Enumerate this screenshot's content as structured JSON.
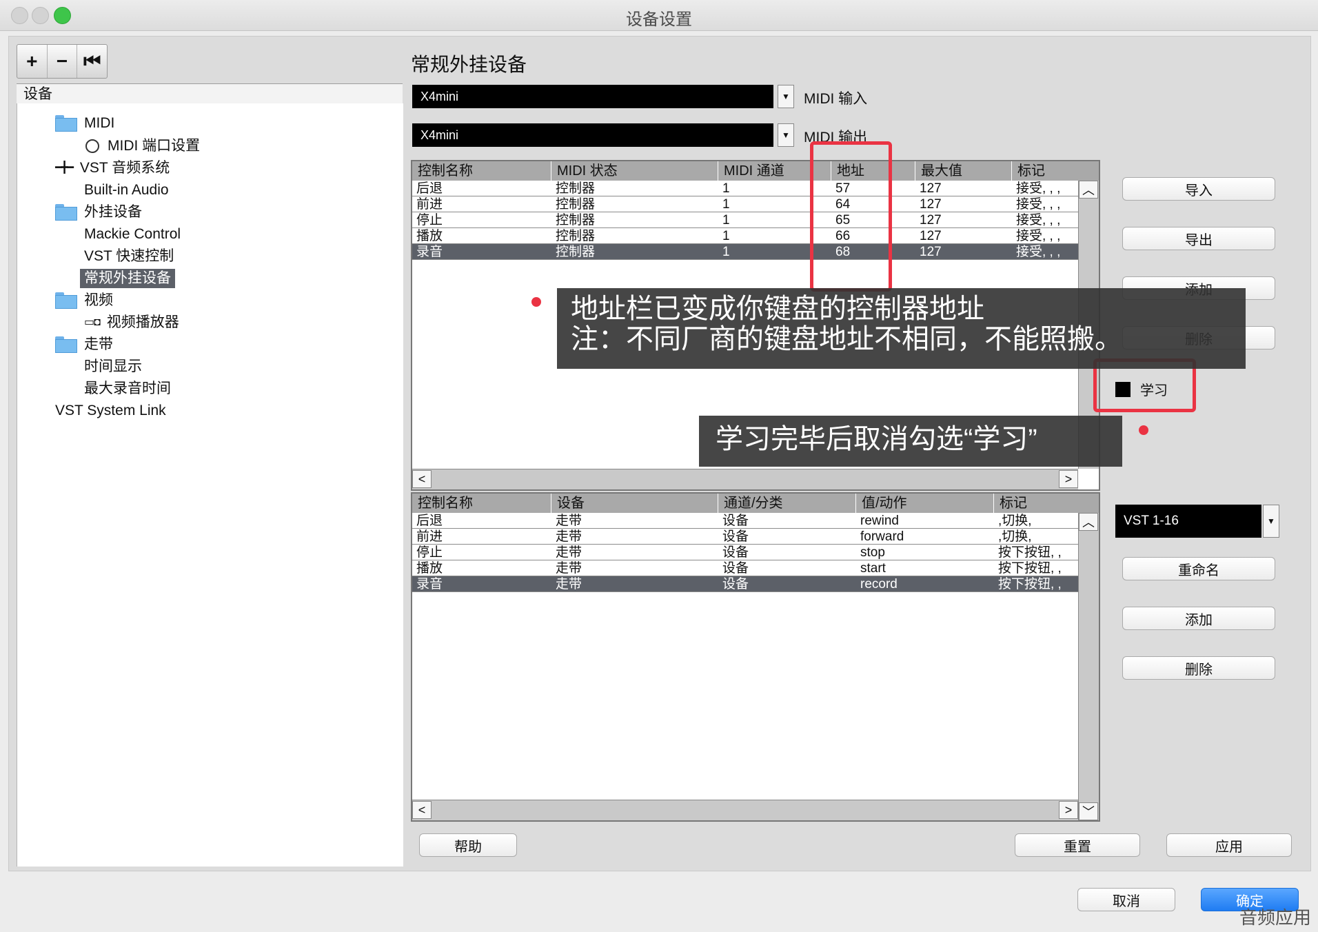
{
  "window": {
    "title": "设备设置"
  },
  "toolbar": {
    "add": "+",
    "remove": "−",
    "reset": "⏮"
  },
  "sidebar": {
    "header": "设备",
    "items": [
      {
        "label": "MIDI",
        "icon": "folder-icon"
      },
      {
        "label": "MIDI 端口设置",
        "icon": "clock-icon"
      },
      {
        "label": "VST 音频系统",
        "icon": "audio-icon"
      },
      {
        "label": "Built-in Audio"
      },
      {
        "label": "外挂设备",
        "icon": "folder-icon"
      },
      {
        "label": "Mackie Control"
      },
      {
        "label": "VST 快速控制"
      },
      {
        "label": "常规外挂设备",
        "selected": true
      },
      {
        "label": "视频",
        "icon": "folder-icon"
      },
      {
        "label": "视频播放器",
        "icon": "video-icon"
      },
      {
        "label": "走带",
        "icon": "folder-icon"
      },
      {
        "label": "时间显示"
      },
      {
        "label": "最大录音时间"
      },
      {
        "label": "VST System Link"
      }
    ]
  },
  "main": {
    "title": "常规外挂设备",
    "midi_input": {
      "value": "X4mini",
      "label": "MIDI 输入"
    },
    "midi_output": {
      "value": "X4mini",
      "label": "MIDI 输出"
    },
    "table1": {
      "headers": [
        "控制名称",
        "MIDI 状态",
        "MIDI 通道",
        "地址",
        "最大值",
        "标记"
      ],
      "rows": [
        [
          "后退",
          "控制器",
          "1",
          "57",
          "127",
          "接受, , ,"
        ],
        [
          "前进",
          "控制器",
          "1",
          "64",
          "127",
          "接受, , ,"
        ],
        [
          "停止",
          "控制器",
          "1",
          "65",
          "127",
          "接受, , ,"
        ],
        [
          "播放",
          "控制器",
          "1",
          "66",
          "127",
          "接受, , ,"
        ],
        [
          "录音",
          "控制器",
          "1",
          "68",
          "127",
          "接受, , ,"
        ]
      ]
    },
    "table2": {
      "headers": [
        "控制名称",
        "设备",
        "通道/分类",
        "值/动作",
        "标记"
      ],
      "rows": [
        [
          "后退",
          "走带",
          "设备",
          "rewind",
          ",切换,"
        ],
        [
          "前进",
          "走带",
          "设备",
          "forward",
          ",切换,"
        ],
        [
          "停止",
          "走带",
          "设备",
          "stop",
          "按下按钮, ,"
        ],
        [
          "播放",
          "走带",
          "设备",
          "start",
          "按下按钮, ,"
        ],
        [
          "录音",
          "走带",
          "设备",
          "record",
          "按下按钮, ,"
        ]
      ]
    },
    "right_buttons": {
      "import": "导入",
      "export": "导出",
      "add": "添加",
      "delete": "删除",
      "learn": "学习"
    },
    "vst_select": "VST 1-16",
    "right_buttons2": {
      "rename": "重命名",
      "add": "添加",
      "delete": "删除"
    }
  },
  "bottom": {
    "help": "帮助",
    "reset": "重置",
    "apply": "应用"
  },
  "footer": {
    "cancel": "取消",
    "ok": "确定"
  },
  "annotations": {
    "callout1_line1": "地址栏已变成你键盘的控制器地址",
    "callout1_line2": "注：不同厂商的键盘地址不相同，不能照搬。",
    "callout2": "学习完毕后取消勾选“学习”"
  },
  "watermark": "音频应用",
  "colors": {
    "selection": "#5c6068",
    "highlight": "#ea3343",
    "primary": "#1f7cf2"
  }
}
